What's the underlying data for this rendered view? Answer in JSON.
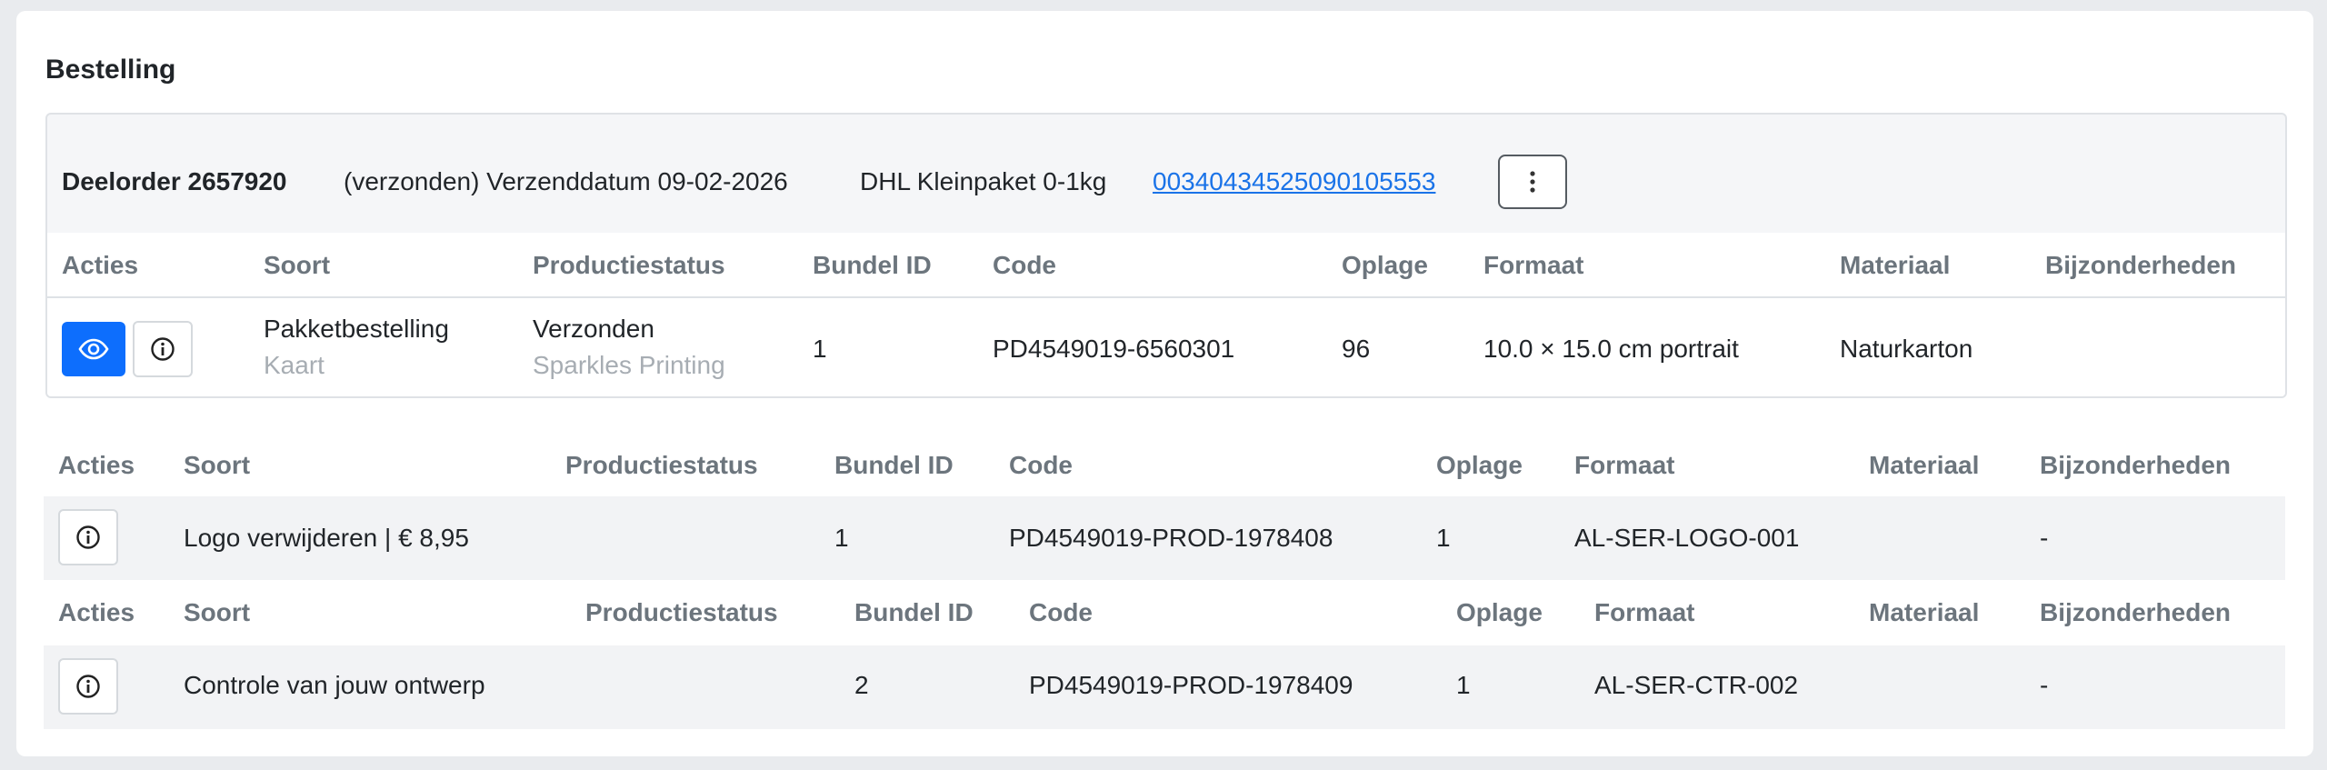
{
  "page": {
    "title": "Bestelling"
  },
  "suborder": {
    "title": "Deelorder 2657920",
    "status": "(verzonden) Verzenddatum 09-02-2026",
    "carrier": "DHL Kleinpaket 0-1kg",
    "tracking": "00340434525090105553",
    "headers": {
      "acties": "Acties",
      "soort": "Soort",
      "productiestatus": "Productiestatus",
      "bundel": "Bundel ID",
      "code": "Code",
      "oplage": "Oplage",
      "formaat": "Formaat",
      "materiaal": "Materiaal",
      "bijzonderheden": "Bijzonderheden"
    },
    "row": {
      "soort": "Pakketbestelling",
      "soort_sub": "Kaart",
      "productiestatus": "Verzonden",
      "productiestatus_sub": "Sparkles Printing",
      "bundel": "1",
      "code": "PD4549019-6560301",
      "oplage": "96",
      "formaat": "10.0 × 15.0 cm portrait",
      "materiaal": "Naturkarton",
      "bijzonderheden": ""
    }
  },
  "extras": [
    {
      "headers": {
        "acties": "Acties",
        "soort": "Soort",
        "productiestatus": "Productiestatus",
        "bundel": "Bundel ID",
        "code": "Code",
        "oplage": "Oplage",
        "formaat": "Formaat",
        "materiaal": "Materiaal",
        "bijzonderheden": "Bijzonderheden"
      },
      "row": {
        "soort": "Logo verwijderen | € 8,95",
        "productiestatus": "",
        "bundel": "1",
        "code": "PD4549019-PROD-1978408",
        "oplage": "1",
        "formaat": "AL-SER-LOGO-001",
        "materiaal": "",
        "bijzonderheden": "-"
      }
    },
    {
      "headers": {
        "acties": "Acties",
        "soort": "Soort",
        "productiestatus": "Productiestatus",
        "bundel": "Bundel ID",
        "code": "Code",
        "oplage": "Oplage",
        "formaat": "Formaat",
        "materiaal": "Materiaal",
        "bijzonderheden": "Bijzonderheden"
      },
      "row": {
        "soort": "Controle van jouw ontwerp",
        "productiestatus": "",
        "bundel": "2",
        "code": "PD4549019-PROD-1978409",
        "oplage": "1",
        "formaat": "AL-SER-CTR-002",
        "materiaal": "",
        "bijzonderheden": "-"
      }
    }
  ],
  "icons": {
    "view": "eye-icon",
    "info": "info-circle-icon",
    "more": "vertical-dots-icon"
  },
  "colors": {
    "primary": "#0d6efd",
    "link": "#1a73e8",
    "header_text": "#6c757d",
    "muted_text": "#a7adb3"
  }
}
